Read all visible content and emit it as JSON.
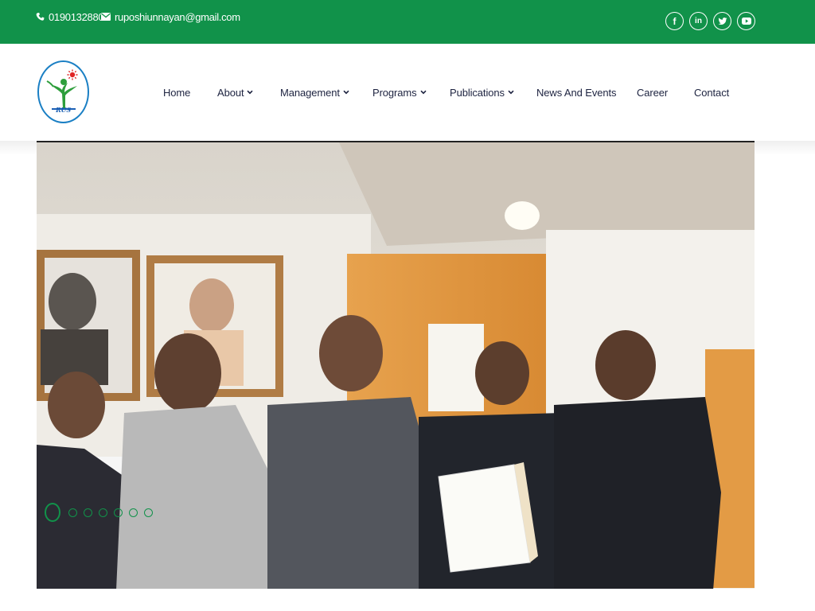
{
  "topbar": {
    "phone": "01901328800",
    "email": "ruposhiunnayan@gmail.com",
    "social": [
      {
        "icon": "facebook-icon",
        "glyph": "f"
      },
      {
        "icon": "linkedin-icon",
        "glyph": "in"
      },
      {
        "icon": "twitter-icon",
        "glyph": ""
      },
      {
        "icon": "youtube-icon",
        "glyph": ""
      }
    ]
  },
  "logo": {
    "wordmark": "RUS"
  },
  "nav": {
    "items": [
      {
        "label": "Home",
        "dropdown": false
      },
      {
        "label": "About",
        "dropdown": true
      },
      {
        "label": "Management",
        "dropdown": true
      },
      {
        "label": "Programs",
        "dropdown": true
      },
      {
        "label": "Publications",
        "dropdown": true
      },
      {
        "label": "News And Events",
        "dropdown": false
      },
      {
        "label": "Career",
        "dropdown": false
      },
      {
        "label": "Contact",
        "dropdown": false
      }
    ]
  },
  "slider": {
    "slide_count": 7,
    "active_index": 0
  },
  "colors": {
    "brand_green": "#11924a",
    "nav_text": "#1d2340",
    "logo_blue": "#1a7fc4"
  }
}
